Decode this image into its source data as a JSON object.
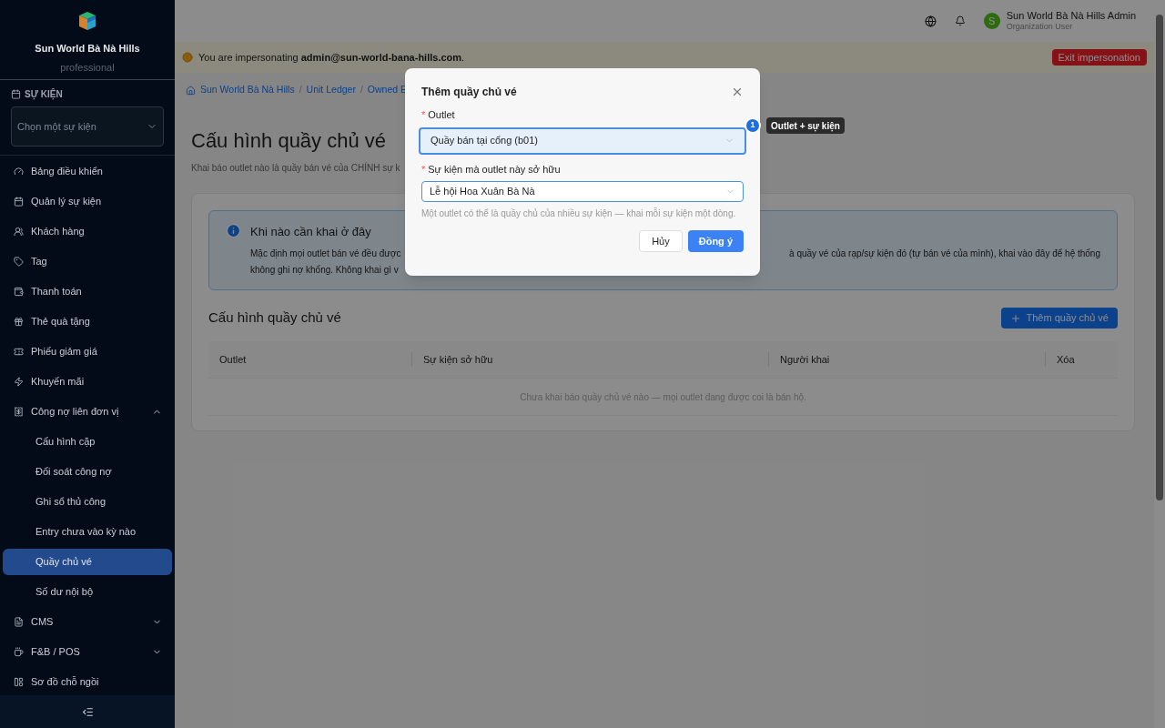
{
  "sidebar": {
    "brand": {
      "name": "Sun World Bà Nà Hills",
      "plan": "professional"
    },
    "event_section": {
      "label": "SỰ KIỆN",
      "select_placeholder": "Chọn một sự kiện"
    },
    "items": [
      {
        "label": "Bảng điều khiển"
      },
      {
        "label": "Quản lý sự kiện"
      },
      {
        "label": "Khách hàng"
      },
      {
        "label": "Tag"
      },
      {
        "label": "Thanh toán"
      },
      {
        "label": "Thẻ quà tặng"
      },
      {
        "label": "Phiếu giảm giá"
      },
      {
        "label": "Khuyến mãi"
      },
      {
        "label": "Công nợ liên đơn vị",
        "expanded": true,
        "children": [
          {
            "label": "Cấu hình cặp",
            "selected": false
          },
          {
            "label": "Đối soát công nợ",
            "selected": false
          },
          {
            "label": "Ghi sổ thủ công",
            "selected": false
          },
          {
            "label": "Entry chưa vào kỳ nào",
            "selected": false
          },
          {
            "label": "Quầy chủ vé",
            "selected": true
          },
          {
            "label": "Số dư nội bộ",
            "selected": false
          }
        ]
      },
      {
        "label": "CMS",
        "expanded": false
      },
      {
        "label": "F&B / POS",
        "expanded": false
      },
      {
        "label": "Sơ đồ chỗ ngồi"
      }
    ]
  },
  "header": {
    "user": {
      "initial": "S",
      "name": "Sun World Bà Nà Hills Admin",
      "role": "Organization User"
    }
  },
  "impersonation_banner": {
    "text": "You are impersonating **admin@sun-world-bana-hills.com**.",
    "button": "Exit impersonation"
  },
  "breadcrumb": {
    "separator": "/",
    "items": [
      "Sun World Bà Nà Hills",
      "Unit Ledger",
      "Owned E"
    ]
  },
  "page": {
    "title": "Cấu hình quầy chủ vé",
    "subtitle": "Khai báo outlet nào là quầy bán vé của CHÍNH sự k",
    "alert": {
      "title": "Khi nào cần khai ở đây",
      "line_1_start": "Mặc định mọi outlet bán vé đều được",
      "line_1_end": "à quầy vé của rạp/sự kiện đó (tự bán vé của mình), khai vào đây để hệ thống",
      "line_2": "không ghi nợ khống. Không khai gì v"
    },
    "section_title": "Cấu hình quầy chủ vé",
    "add_button": "Thêm quầy chủ vé",
    "table": {
      "columns": [
        "Outlet",
        "Sự kiện sở hữu",
        "Người khai",
        "Xóa"
      ],
      "empty_text": "Chưa khai báo quầy chủ vé nào — mọi outlet đang được coi là bán hộ."
    }
  },
  "modal": {
    "title": "Thêm quầy chủ vé",
    "fields": [
      {
        "label": "Outlet",
        "required_mark": "*",
        "value": "Quầy bán tại cổng (b01)",
        "focused": true
      },
      {
        "label": "Sự kiện mà outlet này sở hữu",
        "required_mark": "*",
        "value": "Lễ hội Hoa Xuân Bà Nà",
        "focused": false,
        "help": "Một outlet có thể là quầy chủ của nhiều sự kiện — khai mỗi sự kiện một dòng."
      }
    ],
    "buttons": {
      "cancel": "Hủy",
      "ok": "Đồng ý"
    }
  },
  "annotation": {
    "number": "1",
    "text": "Outlet + sự kiện"
  }
}
